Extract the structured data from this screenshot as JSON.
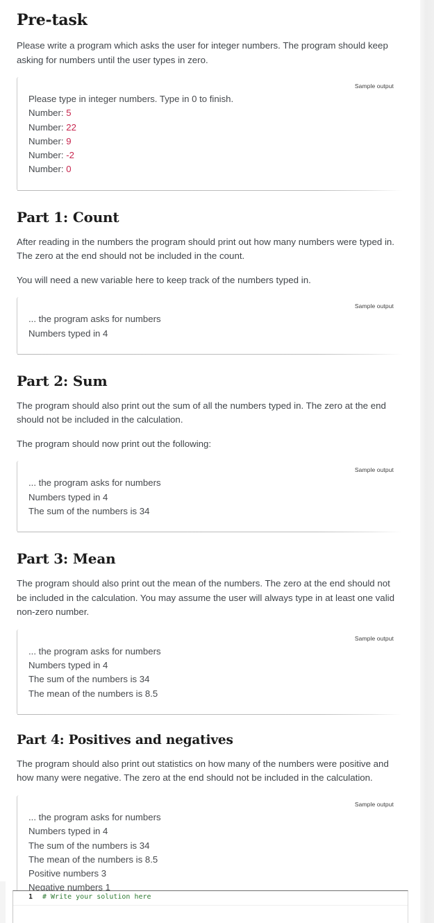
{
  "sections": [
    {
      "heading": "Pre-task",
      "heading_size": "large",
      "paragraphs": [
        "Please write a program which asks the user for integer numbers. The program should keep asking for numbers until the user types in zero."
      ],
      "sample": {
        "label": "Sample output",
        "lines": [
          {
            "text": "Please type in integer numbers. Type in 0 to finish.",
            "input": ""
          },
          {
            "text": "Number: ",
            "input": "5"
          },
          {
            "text": "Number: ",
            "input": "22"
          },
          {
            "text": "Number: ",
            "input": "9"
          },
          {
            "text": "Number: ",
            "input": "-2"
          },
          {
            "text": "Number: ",
            "input": "0"
          }
        ]
      }
    },
    {
      "heading": "Part 1: Count",
      "heading_size": "normal",
      "paragraphs": [
        "After reading in the numbers the program should print out how many numbers were typed in. The zero at the end should not be included in the count.",
        "You will need a new variable here to keep track of the numbers typed in."
      ],
      "sample": {
        "label": "Sample output",
        "lines": [
          {
            "text": "... the program asks for numbers",
            "input": ""
          },
          {
            "text": "Numbers typed in 4",
            "input": ""
          }
        ]
      }
    },
    {
      "heading": "Part 2: Sum",
      "heading_size": "normal",
      "paragraphs": [
        "The program should also print out the sum of all the numbers typed in. The zero at the end should not be included in the calculation.",
        "The program should now print out the following:"
      ],
      "sample": {
        "label": "Sample output",
        "lines": [
          {
            "text": "... the program asks for numbers",
            "input": ""
          },
          {
            "text": "Numbers typed in 4",
            "input": ""
          },
          {
            "text": "The sum of the numbers is 34",
            "input": ""
          }
        ]
      }
    },
    {
      "heading": "Part 3: Mean",
      "heading_size": "normal",
      "paragraphs": [
        "The program should also print out the mean of the numbers. The zero at the end should not be included in the calculation. You may assume the user will always type in at least one valid non-zero number."
      ],
      "sample": {
        "label": "Sample output",
        "lines": [
          {
            "text": "... the program asks for numbers",
            "input": ""
          },
          {
            "text": "Numbers typed in 4",
            "input": ""
          },
          {
            "text": "The sum of the numbers is 34",
            "input": ""
          },
          {
            "text": "The mean of the numbers is 8.5",
            "input": ""
          }
        ]
      }
    },
    {
      "heading": "Part 4: Positives and negatives",
      "heading_size": "small",
      "paragraphs": [
        "The program should also print out statistics on how many of the numbers were positive and how many were negative. The zero at the end should not be included in the calculation."
      ],
      "sample": {
        "label": "Sample output",
        "lines": [
          {
            "text": "... the program asks for numbers",
            "input": ""
          },
          {
            "text": "Numbers typed in 4",
            "input": ""
          },
          {
            "text": "The sum of the numbers is 34",
            "input": ""
          },
          {
            "text": "The mean of the numbers is 8.5",
            "input": ""
          },
          {
            "text": "Positive numbers 3",
            "input": ""
          },
          {
            "text": "Negative numbers 1",
            "input": ""
          }
        ]
      }
    }
  ],
  "editor": {
    "line_number": "1",
    "code": "# Write your solution here"
  },
  "colors": {
    "user_input": "#c7254e",
    "comment": "#2f7a34",
    "heading": "#1b1b1b",
    "body": "#40454a"
  }
}
